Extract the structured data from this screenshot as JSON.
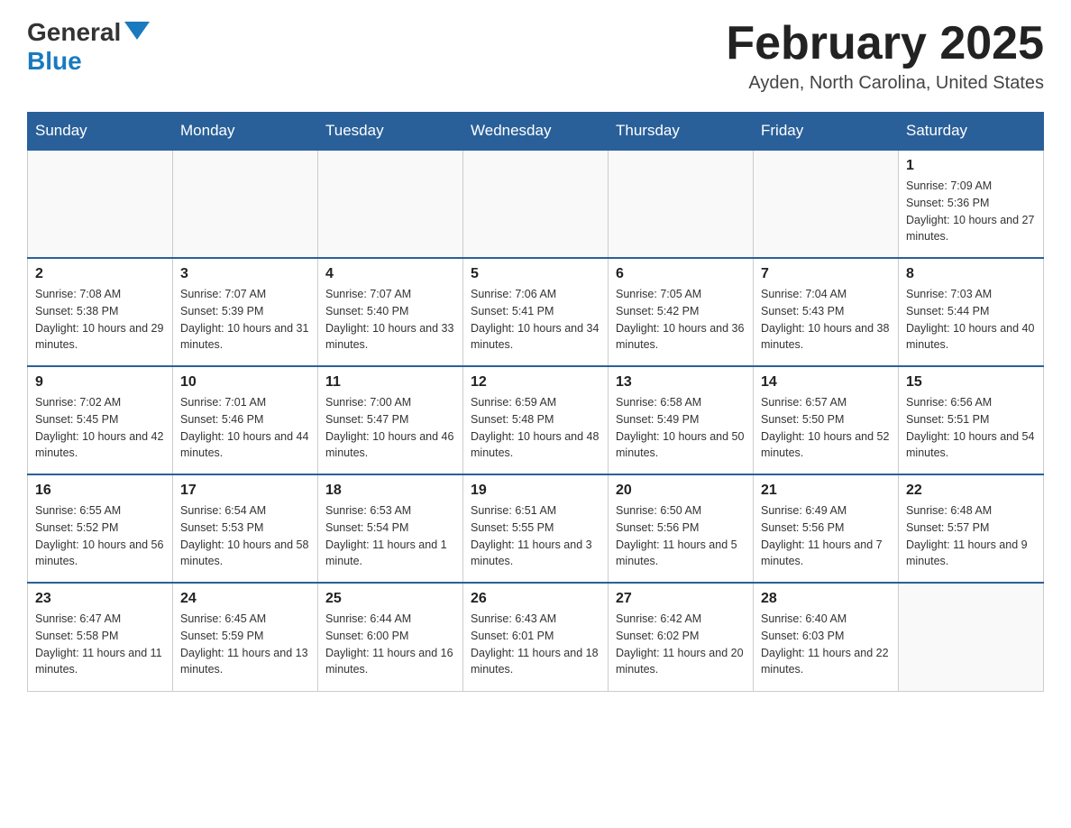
{
  "header": {
    "logo_general": "General",
    "logo_blue": "Blue",
    "month_title": "February 2025",
    "location": "Ayden, North Carolina, United States"
  },
  "weekdays": [
    "Sunday",
    "Monday",
    "Tuesday",
    "Wednesday",
    "Thursday",
    "Friday",
    "Saturday"
  ],
  "weeks": [
    [
      {
        "day": "",
        "sunrise": "",
        "sunset": "",
        "daylight": ""
      },
      {
        "day": "",
        "sunrise": "",
        "sunset": "",
        "daylight": ""
      },
      {
        "day": "",
        "sunrise": "",
        "sunset": "",
        "daylight": ""
      },
      {
        "day": "",
        "sunrise": "",
        "sunset": "",
        "daylight": ""
      },
      {
        "day": "",
        "sunrise": "",
        "sunset": "",
        "daylight": ""
      },
      {
        "day": "",
        "sunrise": "",
        "sunset": "",
        "daylight": ""
      },
      {
        "day": "1",
        "sunrise": "Sunrise: 7:09 AM",
        "sunset": "Sunset: 5:36 PM",
        "daylight": "Daylight: 10 hours and 27 minutes."
      }
    ],
    [
      {
        "day": "2",
        "sunrise": "Sunrise: 7:08 AM",
        "sunset": "Sunset: 5:38 PM",
        "daylight": "Daylight: 10 hours and 29 minutes."
      },
      {
        "day": "3",
        "sunrise": "Sunrise: 7:07 AM",
        "sunset": "Sunset: 5:39 PM",
        "daylight": "Daylight: 10 hours and 31 minutes."
      },
      {
        "day": "4",
        "sunrise": "Sunrise: 7:07 AM",
        "sunset": "Sunset: 5:40 PM",
        "daylight": "Daylight: 10 hours and 33 minutes."
      },
      {
        "day": "5",
        "sunrise": "Sunrise: 7:06 AM",
        "sunset": "Sunset: 5:41 PM",
        "daylight": "Daylight: 10 hours and 34 minutes."
      },
      {
        "day": "6",
        "sunrise": "Sunrise: 7:05 AM",
        "sunset": "Sunset: 5:42 PM",
        "daylight": "Daylight: 10 hours and 36 minutes."
      },
      {
        "day": "7",
        "sunrise": "Sunrise: 7:04 AM",
        "sunset": "Sunset: 5:43 PM",
        "daylight": "Daylight: 10 hours and 38 minutes."
      },
      {
        "day": "8",
        "sunrise": "Sunrise: 7:03 AM",
        "sunset": "Sunset: 5:44 PM",
        "daylight": "Daylight: 10 hours and 40 minutes."
      }
    ],
    [
      {
        "day": "9",
        "sunrise": "Sunrise: 7:02 AM",
        "sunset": "Sunset: 5:45 PM",
        "daylight": "Daylight: 10 hours and 42 minutes."
      },
      {
        "day": "10",
        "sunrise": "Sunrise: 7:01 AM",
        "sunset": "Sunset: 5:46 PM",
        "daylight": "Daylight: 10 hours and 44 minutes."
      },
      {
        "day": "11",
        "sunrise": "Sunrise: 7:00 AM",
        "sunset": "Sunset: 5:47 PM",
        "daylight": "Daylight: 10 hours and 46 minutes."
      },
      {
        "day": "12",
        "sunrise": "Sunrise: 6:59 AM",
        "sunset": "Sunset: 5:48 PM",
        "daylight": "Daylight: 10 hours and 48 minutes."
      },
      {
        "day": "13",
        "sunrise": "Sunrise: 6:58 AM",
        "sunset": "Sunset: 5:49 PM",
        "daylight": "Daylight: 10 hours and 50 minutes."
      },
      {
        "day": "14",
        "sunrise": "Sunrise: 6:57 AM",
        "sunset": "Sunset: 5:50 PM",
        "daylight": "Daylight: 10 hours and 52 minutes."
      },
      {
        "day": "15",
        "sunrise": "Sunrise: 6:56 AM",
        "sunset": "Sunset: 5:51 PM",
        "daylight": "Daylight: 10 hours and 54 minutes."
      }
    ],
    [
      {
        "day": "16",
        "sunrise": "Sunrise: 6:55 AM",
        "sunset": "Sunset: 5:52 PM",
        "daylight": "Daylight: 10 hours and 56 minutes."
      },
      {
        "day": "17",
        "sunrise": "Sunrise: 6:54 AM",
        "sunset": "Sunset: 5:53 PM",
        "daylight": "Daylight: 10 hours and 58 minutes."
      },
      {
        "day": "18",
        "sunrise": "Sunrise: 6:53 AM",
        "sunset": "Sunset: 5:54 PM",
        "daylight": "Daylight: 11 hours and 1 minute."
      },
      {
        "day": "19",
        "sunrise": "Sunrise: 6:51 AM",
        "sunset": "Sunset: 5:55 PM",
        "daylight": "Daylight: 11 hours and 3 minutes."
      },
      {
        "day": "20",
        "sunrise": "Sunrise: 6:50 AM",
        "sunset": "Sunset: 5:56 PM",
        "daylight": "Daylight: 11 hours and 5 minutes."
      },
      {
        "day": "21",
        "sunrise": "Sunrise: 6:49 AM",
        "sunset": "Sunset: 5:56 PM",
        "daylight": "Daylight: 11 hours and 7 minutes."
      },
      {
        "day": "22",
        "sunrise": "Sunrise: 6:48 AM",
        "sunset": "Sunset: 5:57 PM",
        "daylight": "Daylight: 11 hours and 9 minutes."
      }
    ],
    [
      {
        "day": "23",
        "sunrise": "Sunrise: 6:47 AM",
        "sunset": "Sunset: 5:58 PM",
        "daylight": "Daylight: 11 hours and 11 minutes."
      },
      {
        "day": "24",
        "sunrise": "Sunrise: 6:45 AM",
        "sunset": "Sunset: 5:59 PM",
        "daylight": "Daylight: 11 hours and 13 minutes."
      },
      {
        "day": "25",
        "sunrise": "Sunrise: 6:44 AM",
        "sunset": "Sunset: 6:00 PM",
        "daylight": "Daylight: 11 hours and 16 minutes."
      },
      {
        "day": "26",
        "sunrise": "Sunrise: 6:43 AM",
        "sunset": "Sunset: 6:01 PM",
        "daylight": "Daylight: 11 hours and 18 minutes."
      },
      {
        "day": "27",
        "sunrise": "Sunrise: 6:42 AM",
        "sunset": "Sunset: 6:02 PM",
        "daylight": "Daylight: 11 hours and 20 minutes."
      },
      {
        "day": "28",
        "sunrise": "Sunrise: 6:40 AM",
        "sunset": "Sunset: 6:03 PM",
        "daylight": "Daylight: 11 hours and 22 minutes."
      },
      {
        "day": "",
        "sunrise": "",
        "sunset": "",
        "daylight": ""
      }
    ]
  ]
}
